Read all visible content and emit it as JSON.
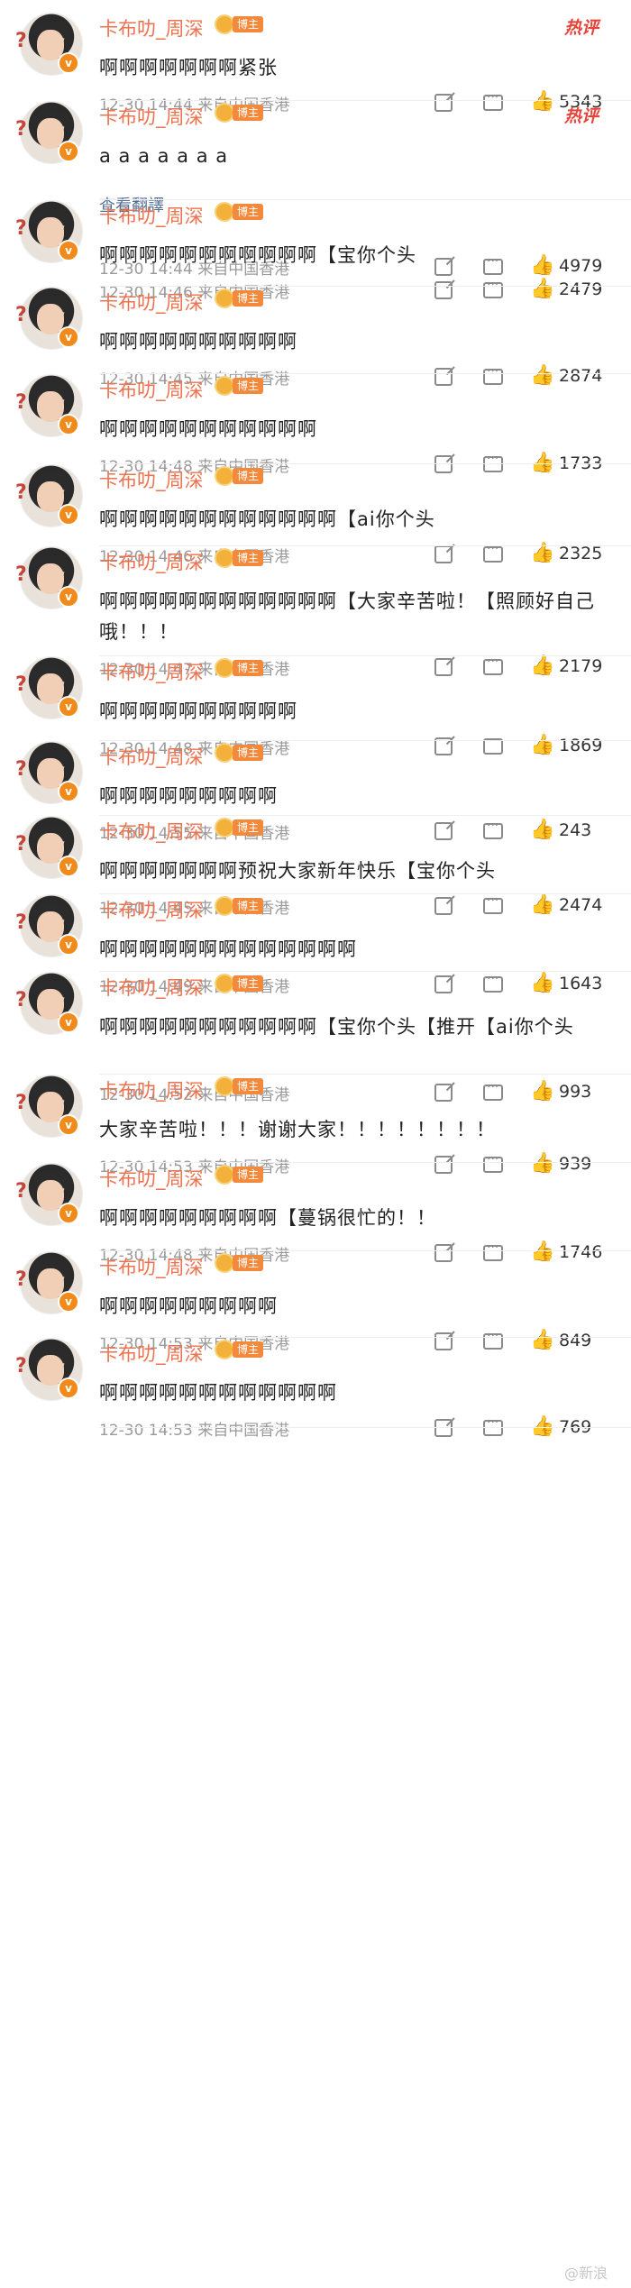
{
  "user": {
    "name": "卡布叻_周深",
    "badge": "博主"
  },
  "hot_label": "热评",
  "translate_label": "查看翻譯",
  "watermark": "@新浪",
  "comments": [
    {
      "text": "啊啊啊啊啊啊啊紧张",
      "meta": "12-30 14:44  来自中国香港",
      "likes": "5343",
      "hot": true
    },
    {
      "text": "a a a a a a a",
      "meta": "12-30 14:44  来自中国香港",
      "likes": "4979",
      "hot": true,
      "translate": true
    },
    {
      "text": "啊啊啊啊啊啊啊啊啊啊啊【宝你个头",
      "meta": "12-30 14:46  来自中国香港",
      "likes": "2479"
    },
    {
      "text": "啊啊啊啊啊啊啊啊啊啊",
      "meta": "12-30 14:45  来自中国香港",
      "likes": "2874"
    },
    {
      "text": "啊啊啊啊啊啊啊啊啊啊啊",
      "meta": "12-30 14:48  来自中国香港",
      "likes": "1733"
    },
    {
      "text": "啊啊啊啊啊啊啊啊啊啊啊啊【ai你个头",
      "meta": "12-30 14:46  来自中国香港",
      "likes": "2325"
    },
    {
      "text": "啊啊啊啊啊啊啊啊啊啊啊啊【大家辛苦啦！【照顾好自己哦！！！",
      "meta": "12-30 14:47  来自中国香港",
      "likes": "2179"
    },
    {
      "text": "啊啊啊啊啊啊啊啊啊啊",
      "meta": "12-30 14:48  来自中国香港",
      "likes": "1869"
    },
    {
      "text": "啊啊啊啊啊啊啊啊啊",
      "meta": "12-30 14:55  来自中国香港",
      "likes": "243"
    },
    {
      "text": "啊啊啊啊啊啊啊预祝大家新年快乐【宝你个头",
      "meta": "12-30 14:45  来自中国香港",
      "likes": "2474"
    },
    {
      "text": "啊啊啊啊啊啊啊啊啊啊啊啊啊",
      "meta": "12-30 14:49  来自中国香港",
      "likes": "1643"
    },
    {
      "text": "啊啊啊啊啊啊啊啊啊啊啊【宝你个头【推开【ai你个头",
      "meta": "12-30 14:52  来自中国香港",
      "likes": "993"
    },
    {
      "text": "大家辛苦啦！！！谢谢大家！！！！！！！！",
      "meta": "12-30 14:53  来自中国香港",
      "likes": "939"
    },
    {
      "text": "啊啊啊啊啊啊啊啊啊【蔓锅很忙的！！",
      "meta": "12-30 14:48  来自中国香港",
      "likes": "1746"
    },
    {
      "text": "啊啊啊啊啊啊啊啊啊",
      "meta": "12-30 14:53  来自中国香港",
      "likes": "849"
    },
    {
      "text": "啊啊啊啊啊啊啊啊啊啊啊啊",
      "meta": "12-30 14:53  来自中国香港",
      "likes": "769"
    }
  ]
}
